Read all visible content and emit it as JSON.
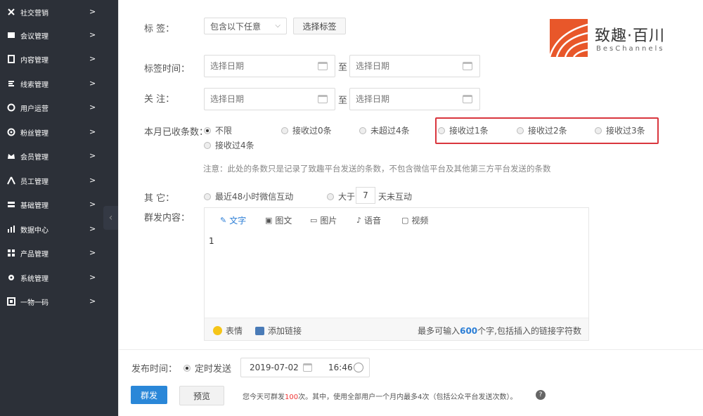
{
  "sidebar": {
    "items": [
      {
        "label": "社交营销",
        "icon": "share-icon"
      },
      {
        "label": "会议管理",
        "icon": "meeting-icon"
      },
      {
        "label": "内容管理",
        "icon": "document-icon"
      },
      {
        "label": "线索管理",
        "icon": "clue-icon"
      },
      {
        "label": "用户运营",
        "icon": "user-ops-icon"
      },
      {
        "label": "粉丝管理",
        "icon": "fans-icon"
      },
      {
        "label": "会员管理",
        "icon": "member-icon"
      },
      {
        "label": "员工管理",
        "icon": "staff-icon"
      },
      {
        "label": "基础管理",
        "icon": "base-icon"
      },
      {
        "label": "数据中心",
        "icon": "chart-icon"
      },
      {
        "label": "产品管理",
        "icon": "grid-icon"
      },
      {
        "label": "系统管理",
        "icon": "gear-icon"
      },
      {
        "label": "一物一码",
        "icon": "code-icon"
      }
    ],
    "arrow": ">",
    "collapse": "‹"
  },
  "logo": {
    "cn": "致趣·百川",
    "en": "BesChannels",
    "color": "#e8572a"
  },
  "form": {
    "tag_label": "标 签：",
    "tag_select": "包含以下任意",
    "tag_button": "选择标签",
    "tag_time_label": "标签时间：",
    "follow_label": "关 注：",
    "date_placeholder": "选择日期",
    "to": "至",
    "received_label": "本月已收条数：",
    "received_options": [
      "不限",
      "接收过0条",
      "未超过4条",
      "接收过1条",
      "接收过2条",
      "接收过3条",
      "接收过4条"
    ],
    "note": "注意：此处的条数只是记录了致趣平台发送的条数，不包含微信平台及其他第三方平台发送的条数",
    "other_label": "其 它：",
    "other_opt1": "最近48小时微信互动",
    "other_opt2_pre": "大于",
    "other_days": "7",
    "other_opt2_post": "天未互动",
    "content_label": "群发内容："
  },
  "editor": {
    "tabs": [
      "文字",
      "图文",
      "图片",
      "语音",
      "视频"
    ],
    "body": "1",
    "emoji": "表情",
    "add_link": "添加链接",
    "limit_pre": "最多可输入",
    "limit_num": "600",
    "limit_post": "个字,包括插入的链接字符数"
  },
  "publish": {
    "label": "发布时间：",
    "option": "定时发送",
    "date": "2019-07-02",
    "time": "16:46"
  },
  "actions": {
    "send": "群发",
    "preview": "预览",
    "quota_pre": "您今天可群发",
    "quota_num": "100",
    "quota_post": "次。其中，使用全部用户一个月内最多4次（包括公众平台发送次数）。",
    "help": "?"
  },
  "colors": {
    "accent": "#2a87d8",
    "highlight": "#d9363e",
    "sidebar": "#2c3038"
  }
}
